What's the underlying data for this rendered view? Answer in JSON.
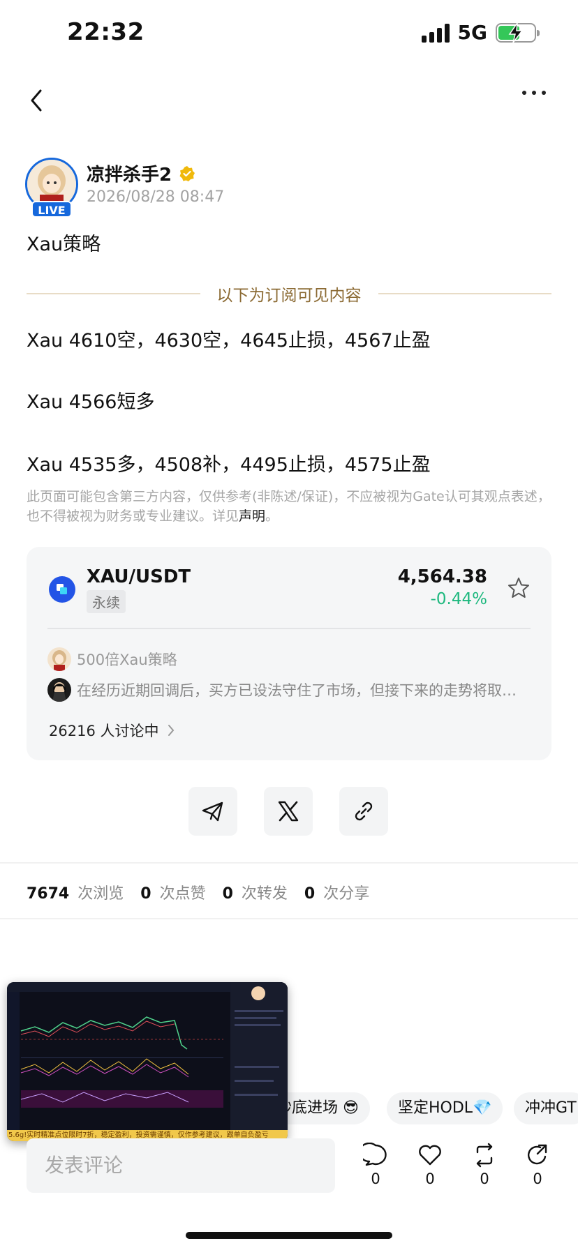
{
  "status_bar": {
    "time": "22:32",
    "network": "5G"
  },
  "author": {
    "name": "凉拌杀手2",
    "live_label": "LIVE",
    "timestamp": "2026/08/28 08:47"
  },
  "post": {
    "title": "Xau策略",
    "divider_text": "以下为订阅可见内容",
    "lines": [
      "Xau 4610空，4630空，4645止损，4567止盈",
      "Xau 4566短多",
      "Xau 4535多，4508补，4495止损，4575止盈"
    ],
    "disclaimer_main": "此页面可能包含第三方内容，仅供参考(非陈述/保证)，不应被视为Gate认可其观点表述，也不得被视为财务或专业建议。详见",
    "disclaimer_link": "声明",
    "disclaimer_end": "。"
  },
  "market_card": {
    "pair": "XAU/USDT",
    "type_tag": "永续",
    "price": "4,564.38",
    "change": "-0.44%",
    "change_color": "#1db87e",
    "discussions": [
      {
        "text": "500倍Xau策略"
      },
      {
        "text": "在经历近期回调后，买方已设法守住了市场，但接下来的走势将取…"
      }
    ],
    "discuss_count": "26216 人讨论中"
  },
  "share_buttons": [
    {
      "name": "telegram-share",
      "icon": "paper-plane-icon"
    },
    {
      "name": "x-share",
      "icon": "x-logo-icon"
    },
    {
      "name": "link-share",
      "icon": "link-icon"
    }
  ],
  "stats": {
    "views": "7674",
    "views_label": "次浏览",
    "likes": "0",
    "likes_label": "次点赞",
    "reposts": "0",
    "reposts_label": "次转发",
    "shares": "0",
    "shares_label": "次分享"
  },
  "tags": [
    "抄底进场 😎",
    "坚定HODL💎",
    "冲冲GT"
  ],
  "floating_video": {
    "caption": "5.6g!实时精准点位限时7折，稳定盈利，投资需谨慎，仅作参考建议，跟单自负盈亏"
  },
  "bottom_bar": {
    "comment_placeholder": "发表评论",
    "comment_count": "0",
    "like_count": "0",
    "repost_count": "0",
    "share_count": "0"
  },
  "colors": {
    "brand_blue": "#1668dc",
    "divider_gold": "#8b6a33",
    "up_green": "#1db87e"
  }
}
